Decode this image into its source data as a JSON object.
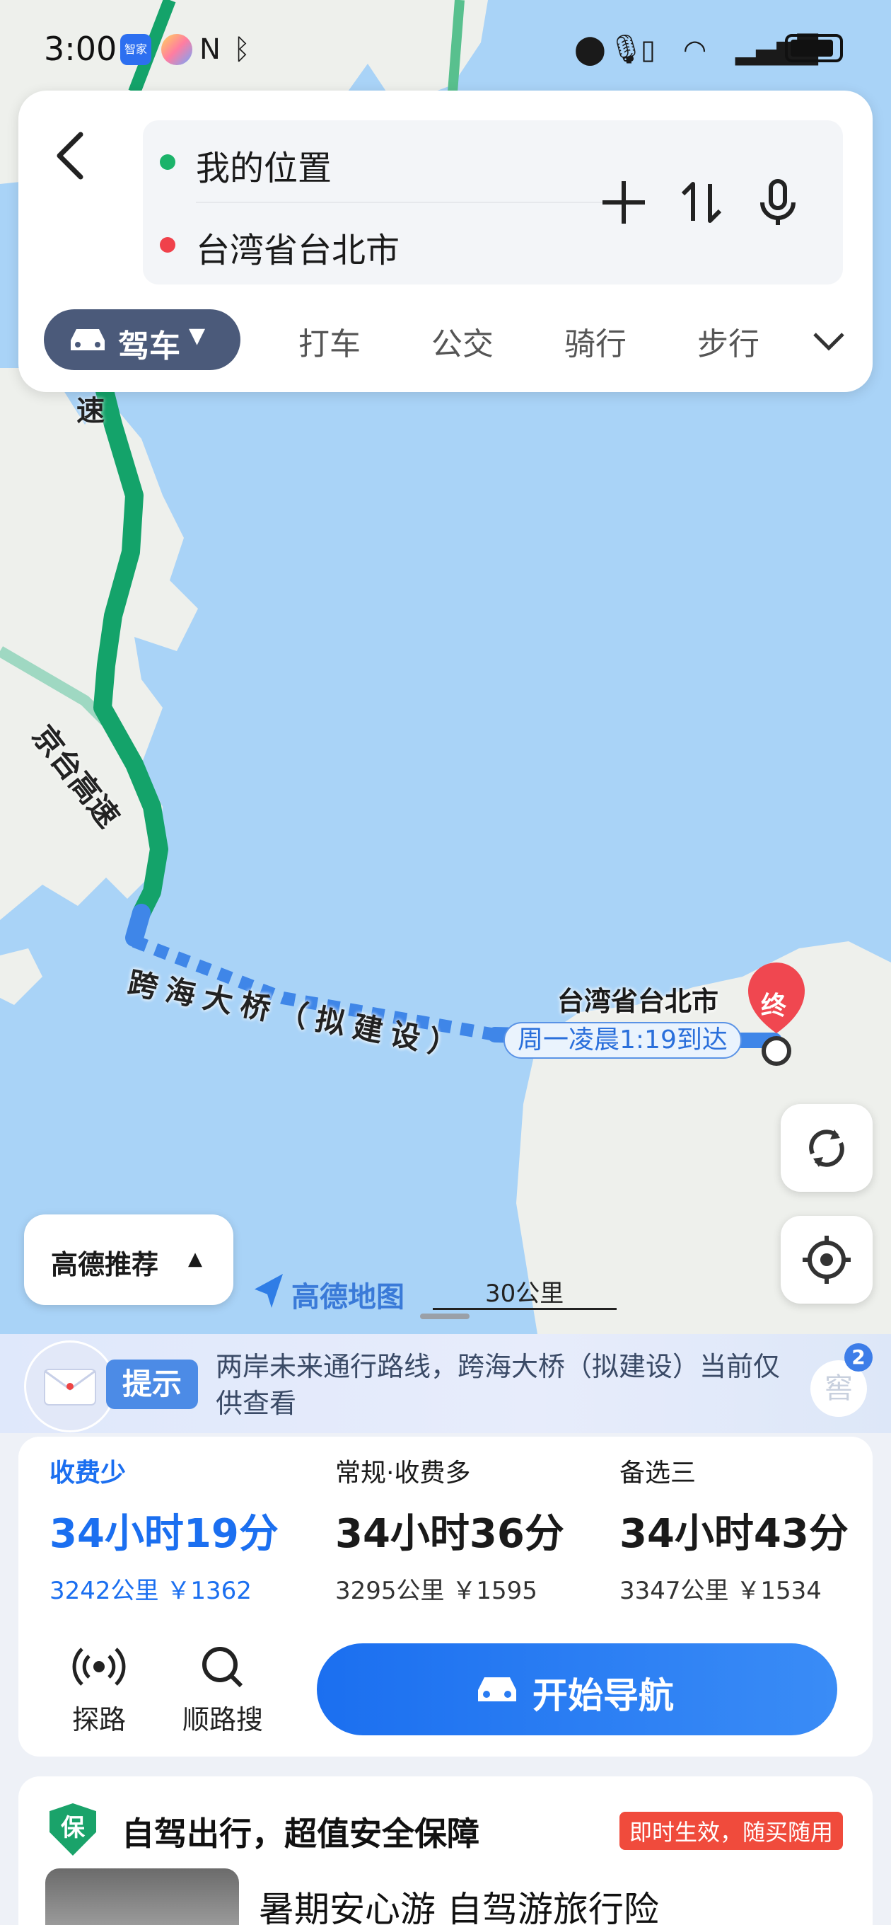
{
  "status_bar": {
    "time": "3:00",
    "app_badge": "智家"
  },
  "search": {
    "origin": "我的位置",
    "destination": "台湾省台北市"
  },
  "modes": {
    "selected": "驾车",
    "items": [
      "打车",
      "公交",
      "骑行",
      "步行"
    ]
  },
  "map": {
    "road_label_top": "速",
    "road_label_main": "京台高速",
    "bridge_label": "跨海大桥（拟建设）",
    "destination_label": "台湾省台北市",
    "destination_marker": "终",
    "eta": "周一凌晨1:19到达",
    "preference": "高德推荐",
    "logo": "高德地图",
    "scale": "30公里"
  },
  "tip": {
    "badge": "提示",
    "text": "两岸未来通行路线，跨海大桥（拟建设）当前仅供查看",
    "avatar_badge": "2",
    "avatar_text": "窖"
  },
  "routes": [
    {
      "tag": "收费少",
      "time": "34小时19分",
      "info": "3242公里 ￥1362"
    },
    {
      "tag": "常规·收费多",
      "time": "34小时36分",
      "info": "3295公里 ￥1595"
    },
    {
      "tag": "备选三",
      "time": "34小时43分",
      "info": "3347公里 ￥1534"
    }
  ],
  "tools": {
    "explore": "探路",
    "search_along": "顺路搜"
  },
  "navigate": "开始导航",
  "insurance": {
    "shield": "保",
    "title": "自驾出行，超值安全保障",
    "tag": "即时生效，随买随用",
    "subtitle": "暑期安心游 自驾游旅行险"
  },
  "colors": {
    "accent": "#1b6ff0",
    "route_green": "#14a36a",
    "sea": "#a9d3f7"
  }
}
